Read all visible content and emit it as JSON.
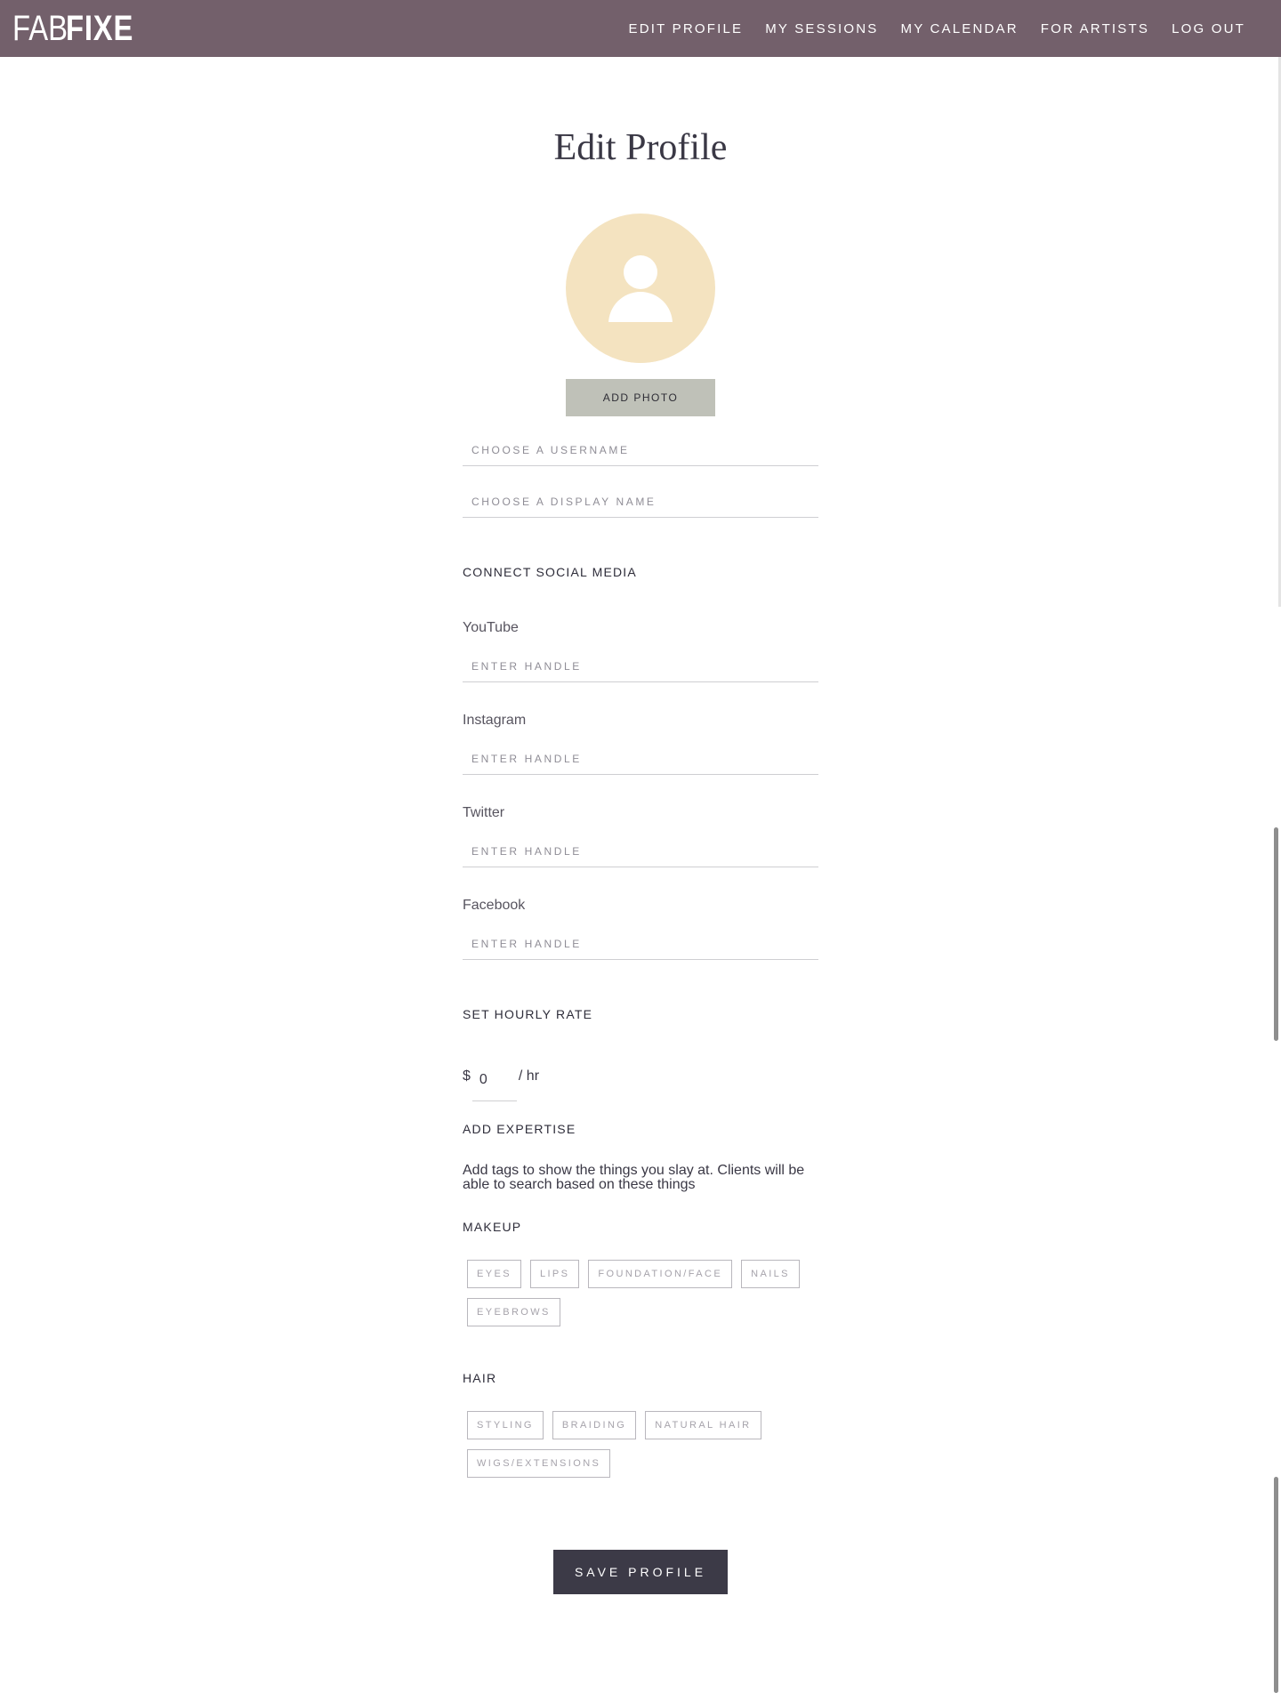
{
  "header": {
    "logo_light": "FAB",
    "logo_bold": "FIXE",
    "nav": [
      "EDIT PROFILE",
      "MY SESSIONS",
      "MY CALENDAR",
      "FOR ARTISTS",
      "LOG OUT"
    ]
  },
  "page": {
    "title": "Edit Profile",
    "add_photo_label": "ADD PHOTO",
    "username_placeholder": "CHOOSE A USERNAME",
    "username_value": "",
    "display_name_placeholder": "CHOOSE A DISPLAY NAME",
    "display_name_value": ""
  },
  "social": {
    "heading": "CONNECT SOCIAL MEDIA",
    "accounts": [
      {
        "label": "YouTube",
        "placeholder": "ENTER HANDLE",
        "value": ""
      },
      {
        "label": "Instagram",
        "placeholder": "ENTER HANDLE",
        "value": ""
      },
      {
        "label": "Twitter",
        "placeholder": "ENTER HANDLE",
        "value": ""
      },
      {
        "label": "Facebook",
        "placeholder": "ENTER HANDLE",
        "value": ""
      }
    ]
  },
  "rate": {
    "heading": "SET HOURLY RATE",
    "currency": "$",
    "value": "0",
    "unit": "/ hr"
  },
  "expertise": {
    "heading": "ADD EXPERTISE",
    "help": "Add tags to show the things you slay at. Clients will be able to search based on these things",
    "groups": [
      {
        "name": "MAKEUP",
        "tags": [
          "EYES",
          "LIPS",
          "FOUNDATION/FACE",
          "NAILS",
          "EYEBROWS"
        ]
      },
      {
        "name": "HAIR",
        "tags": [
          "STYLING",
          "BRAIDING",
          "NATURAL HAIR",
          "WIGS/EXTENSIONS"
        ]
      }
    ]
  },
  "save_label": "SAVE PROFILE",
  "colors": {
    "header_bg": "#73606b",
    "avatar_bg": "#f4e3c0",
    "add_photo_bg": "#bfc1b8",
    "save_bg": "#3c3a47"
  },
  "icons": {
    "avatar": "user-silhouette-icon"
  }
}
